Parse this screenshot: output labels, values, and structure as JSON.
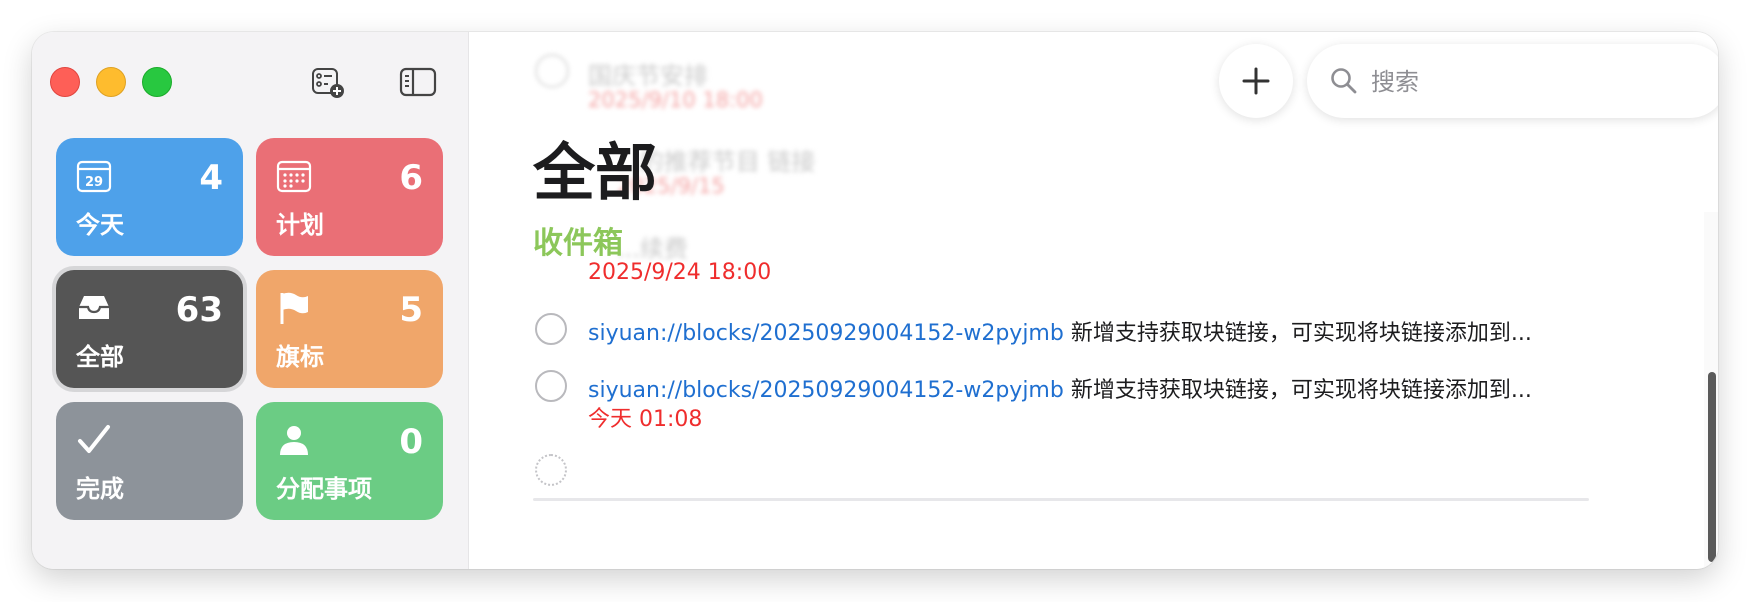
{
  "sidebar": {
    "cards": [
      {
        "id": "today",
        "label": "今天",
        "count": "4",
        "icon": "calendar-today-icon"
      },
      {
        "id": "plan",
        "label": "计划",
        "count": "6",
        "icon": "calendar-grid-icon"
      },
      {
        "id": "all",
        "label": "全部",
        "count": "63",
        "icon": "tray-icon"
      },
      {
        "id": "flag",
        "label": "旗标",
        "count": "5",
        "icon": "flag-icon"
      },
      {
        "id": "done",
        "label": "完成",
        "count": "",
        "icon": "checkmark-icon"
      },
      {
        "id": "assign",
        "label": "分配事项",
        "count": "0",
        "icon": "person-icon"
      }
    ],
    "today_day": "29"
  },
  "toolbar": {
    "search_placeholder": "搜索"
  },
  "main": {
    "title": "全部",
    "section": "收件箱",
    "background_items": [
      {
        "text": "国庆节安排",
        "date": "2025/9/10 18:00"
      },
      {
        "text": "...的推荐节目 链接",
        "date": "2025/9/15"
      },
      {
        "text": "...续费",
        "date": ""
      }
    ],
    "tasks": [
      {
        "date": "2025/9/24 18:00"
      },
      {
        "link": "siyuan://blocks/20250929004152-w2pyjmb",
        "text": "新增支持获取块链接，可实现将块链接添加到...",
        "date": ""
      },
      {
        "link": "siyuan://blocks/20250929004152-w2pyjmb",
        "text": "新增支持获取块链接，可实现将块链接添加到...",
        "date": "今天 01:08"
      }
    ]
  },
  "colors": {
    "today": "#4ea1ea",
    "plan": "#ea6f76",
    "all": "#555555",
    "flag": "#f0a66a",
    "done": "#8d939a",
    "assign": "#6bcc84",
    "section": "#8cc75a",
    "link": "#1f6fd0",
    "date": "#ef2d2d"
  }
}
